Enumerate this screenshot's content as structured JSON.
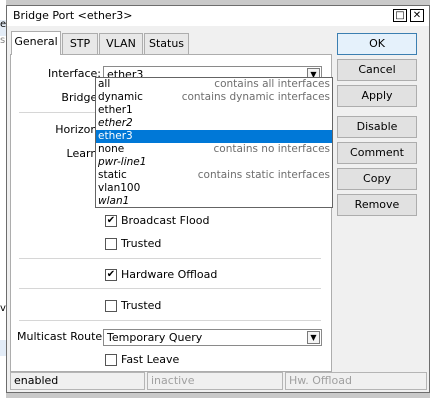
{
  "background": {
    "partial_labels": [
      "e",
      "si",
      "v"
    ]
  },
  "window": {
    "title": "Bridge Port <ether3>",
    "maximize_glyph": "□",
    "close_glyph": "✕"
  },
  "tabs": [
    {
      "label": "General",
      "active": true
    },
    {
      "label": "STP",
      "active": false
    },
    {
      "label": "VLAN",
      "active": false
    },
    {
      "label": "Status",
      "active": false
    }
  ],
  "form": {
    "interface_label": "Interface:",
    "interface_value": "ether3",
    "bridge_label": "Bridge:",
    "horizon_label": "Horizon:",
    "learn_label": "Learn:",
    "broadcast_flood_label": "Broadcast Flood",
    "broadcast_flood_checked": true,
    "trusted1_label": "Trusted",
    "trusted1_checked": false,
    "hw_offload_label": "Hardware Offload",
    "hw_offload_checked": true,
    "trusted2_label": "Trusted",
    "trusted2_checked": false,
    "multicast_router_label": "Multicast Router:",
    "multicast_router_value": "Temporary Query",
    "fast_leave_label": "Fast Leave",
    "fast_leave_checked": false
  },
  "dropdown": {
    "options": [
      {
        "name": "all",
        "desc": "contains all interfaces",
        "italic": false,
        "selected": false
      },
      {
        "name": "dynamic",
        "desc": "contains dynamic interfaces",
        "italic": false,
        "selected": false
      },
      {
        "name": "ether1",
        "desc": "",
        "italic": false,
        "selected": false
      },
      {
        "name": "ether2",
        "desc": "",
        "italic": true,
        "selected": false
      },
      {
        "name": "ether3",
        "desc": "",
        "italic": false,
        "selected": true
      },
      {
        "name": "none",
        "desc": "contains no interfaces",
        "italic": false,
        "selected": false
      },
      {
        "name": "pwr-line1",
        "desc": "",
        "italic": true,
        "selected": false
      },
      {
        "name": "static",
        "desc": "contains static interfaces",
        "italic": false,
        "selected": false
      },
      {
        "name": "vlan100",
        "desc": "",
        "italic": false,
        "selected": false
      },
      {
        "name": "wlan1",
        "desc": "",
        "italic": true,
        "selected": false
      }
    ]
  },
  "buttons": {
    "ok": "OK",
    "cancel": "Cancel",
    "apply": "Apply",
    "disable": "Disable",
    "comment": "Comment",
    "copy": "Copy",
    "remove": "Remove"
  },
  "status": {
    "state": "enabled",
    "active": "inactive",
    "offload": "Hw. Offload"
  },
  "icons": {
    "dropdown_arrow": "▼",
    "check": "✔"
  }
}
